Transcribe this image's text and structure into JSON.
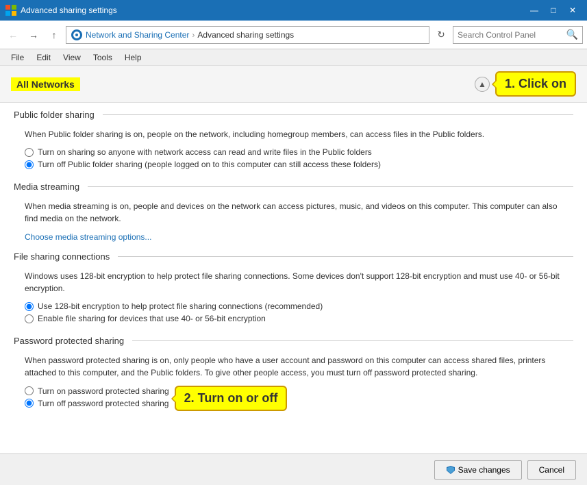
{
  "titlebar": {
    "title": "Advanced sharing settings",
    "min_btn": "—",
    "max_btn": "□",
    "close_btn": "✕"
  },
  "addressbar": {
    "breadcrumb": {
      "network_center": "Network and Sharing Center",
      "advanced_settings": "Advanced sharing settings",
      "sep": "›"
    },
    "search_placeholder": "Search Control Panel"
  },
  "menubar": {
    "items": [
      "File",
      "Edit",
      "View",
      "Tools",
      "Help"
    ]
  },
  "all_networks": {
    "label": "All Networks",
    "callout1": "1. Click on"
  },
  "public_folder": {
    "title": "Public folder sharing",
    "description": "When Public folder sharing is on, people on the network, including homegroup members, can access files in the Public folders.",
    "option1": "Turn on sharing so anyone with network access can read and write files in the Public folders",
    "option2": "Turn off Public folder sharing (people logged on to this computer can still access these folders)",
    "selected": "option2"
  },
  "media_streaming": {
    "title": "Media streaming",
    "description": "When media streaming is on, people and devices on the network can access pictures, music, and videos on this computer. This computer can also find media on the network.",
    "link": "Choose media streaming options..."
  },
  "file_sharing": {
    "title": "File sharing connections",
    "description": "Windows uses 128-bit encryption to help protect file sharing connections. Some devices don't support 128-bit encryption and must use 40- or 56-bit encryption.",
    "option1": "Use 128-bit encryption to help protect file sharing connections (recommended)",
    "option2": "Enable file sharing for devices that use 40- or 56-bit encryption",
    "selected": "option1"
  },
  "password_sharing": {
    "title": "Password protected sharing",
    "description": "When password protected sharing is on, only people who have a user account and password on this computer can access shared files, printers attached to this computer, and the Public folders. To give other people access, you must turn off password protected sharing.",
    "option1": "Turn on password protected sharing",
    "option2": "Turn off password protected sharing",
    "selected": "option2",
    "callout2": "2. Turn on or off"
  },
  "bottombar": {
    "save_label": "Save changes",
    "cancel_label": "Cancel"
  }
}
